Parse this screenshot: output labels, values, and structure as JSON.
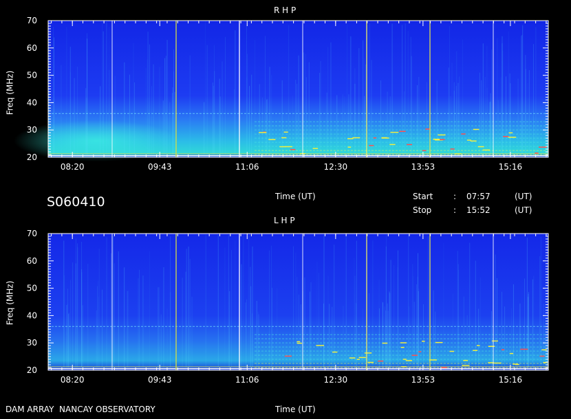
{
  "panels": [
    {
      "title": "R H P",
      "ylabel": "Freq (MHz)",
      "xlabel": "Time (UT)",
      "yticks": [
        20,
        30,
        40,
        50,
        60,
        70
      ],
      "xticks": [
        "08:20",
        "09:43",
        "11:06",
        "12:30",
        "13:53",
        "15:16"
      ]
    },
    {
      "title": "L H P",
      "ylabel": "Freq (MHz)",
      "xlabel": "Time (UT)",
      "yticks": [
        20,
        30,
        40,
        50,
        60,
        70
      ],
      "xticks": [
        "08:20",
        "09:43",
        "11:06",
        "12:30",
        "13:53",
        "15:16"
      ]
    }
  ],
  "info": {
    "id": "S060410",
    "start_label": "Start",
    "start_sep": ":",
    "start_value": "07:57",
    "start_unit": "(UT)",
    "stop_label": "Stop",
    "stop_sep": ":",
    "stop_value": "15:52",
    "stop_unit": "(UT)"
  },
  "footer": "DAM ARRAY  NANCAY OBSERVATORY",
  "chart_data": [
    {
      "type": "heatmap",
      "title": "R H P",
      "xlabel": "Time (UT)",
      "ylabel": "Freq (MHz)",
      "xlim": [
        "07:57",
        "15:52"
      ],
      "ylim": [
        20,
        70
      ],
      "x_ticks": [
        "08:20",
        "09:43",
        "11:06",
        "12:30",
        "13:53",
        "15:16"
      ],
      "y_ticks": [
        20,
        30,
        40,
        50,
        60,
        70
      ],
      "colors": {
        "background": "#000000",
        "low": "#1a2cf0",
        "mid": "#20e8e8",
        "high": "#f0f020",
        "peak": "#ffffff"
      }
    },
    {
      "type": "heatmap",
      "title": "L H P",
      "xlabel": "Time (UT)",
      "ylabel": "Freq (MHz)",
      "xlim": [
        "07:57",
        "15:52"
      ],
      "ylim": [
        20,
        70
      ],
      "x_ticks": [
        "08:20",
        "09:43",
        "11:06",
        "12:30",
        "13:53",
        "15:16"
      ],
      "y_ticks": [
        20,
        30,
        40,
        50,
        60,
        70
      ],
      "colors": {
        "background": "#000000",
        "low": "#1a2cf0",
        "mid": "#20e8e8",
        "high": "#f0f020",
        "peak": "#ffffff"
      }
    }
  ]
}
